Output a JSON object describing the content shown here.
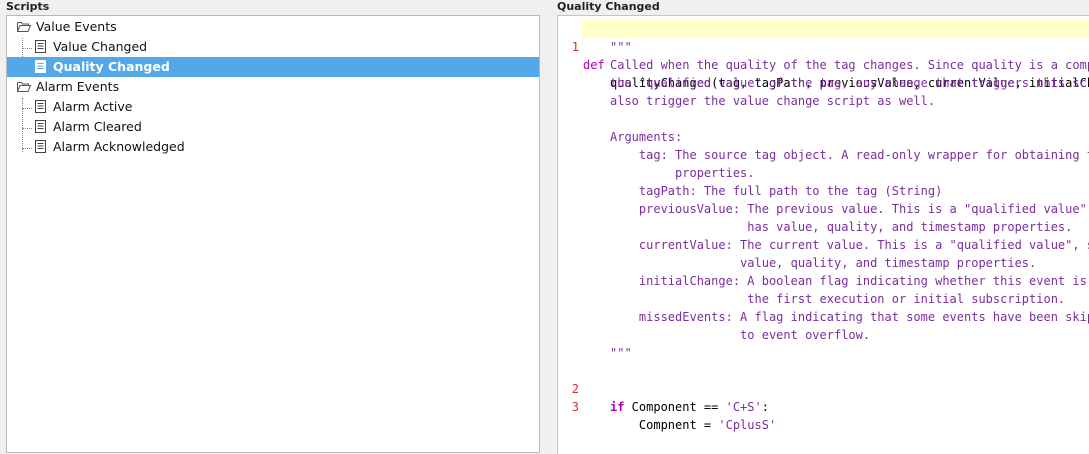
{
  "scripts_panel": {
    "title": "Scripts",
    "groups": [
      {
        "label": "Value Events",
        "items": [
          "Value Changed",
          "Quality Changed"
        ]
      },
      {
        "label": "Alarm Events",
        "items": [
          "Alarm Active",
          "Alarm Cleared",
          "Alarm Acknowledged"
        ]
      }
    ],
    "selected": "Quality Changed"
  },
  "editor": {
    "title": "Quality Changed",
    "line_numbers": [
      "1",
      "2",
      "3"
    ],
    "line1": {
      "keyword": "def",
      "signature": "qualityChanged(tag, tagPath, previousValue, currentValue, initialChange, missedEvents):"
    },
    "docstring": [
      "\"\"\"",
      "Called when the quality of the tag changes. Since quality is a component of",
      "the \"qualified value\" of the tag, any change that triggers this script will",
      "also trigger the value change script as well.",
      "",
      "Arguments:",
      "    tag: The source tag object. A read-only wrapper for obtaining tag",
      "         properties.",
      "    tagPath: The full path to the tag (String)",
      "    previousValue: The previous value. This is a \"qualified value\", so it",
      "                   has value, quality, and timestamp properties.",
      "    currentValue: The current value. This is a \"qualified value\", so it has",
      "                  value, quality, and timestamp properties.",
      "    initialChange: A boolean flag indicating whether this event is due to",
      "                   the first execution or initial subscription.",
      "    missedEvents: A flag indicating that some events have been skipped due",
      "                  to event overflow.",
      "\"\"\""
    ],
    "line2": {
      "keyword": "if",
      "code": " Component == ",
      "string": "'C+S'",
      "tail": ":"
    },
    "line3": {
      "code": "    Compnent = ",
      "string": "'CplusS'"
    }
  },
  "colors": {
    "selection": "#55a8e8",
    "current_line": "#ffffc8",
    "keyword": "#b000b0",
    "docstring": "#7a2e9e",
    "line_number": "#cc3333"
  }
}
